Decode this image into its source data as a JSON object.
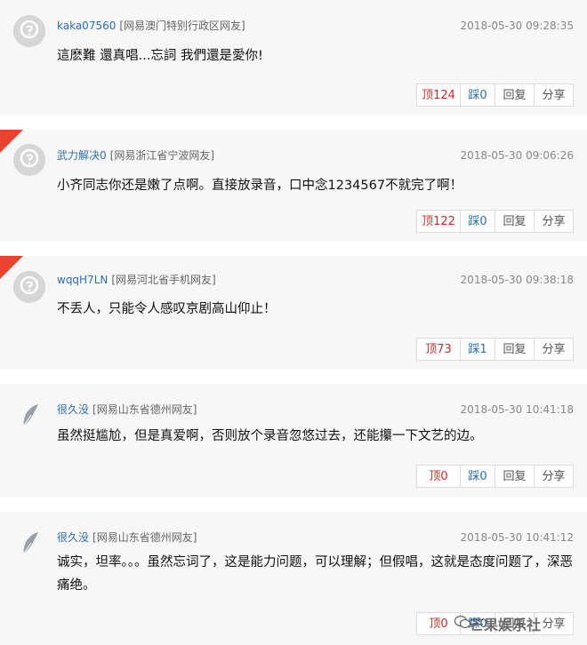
{
  "comments": [
    {
      "username": "kaka07560",
      "location": "[网易澳门特别行政区网友]",
      "timestamp": "2018-05-30 09:28:35",
      "text": "這麽難 還真唱...忘詞 我們還是愛你!",
      "up_label": "顶124",
      "down_label": "踩0",
      "reply_label": "回复",
      "share_label": "分享",
      "hot": false,
      "avatar": "default-avatar"
    },
    {
      "username": "武力解决0",
      "location": "[网易浙江省宁波网友]",
      "timestamp": "2018-05-30 09:06:26",
      "text": "小齐同志你还是嫩了点啊。直接放录音，口中念1234567不就完了啊！",
      "up_label": "顶122",
      "down_label": "踩0",
      "reply_label": "回复",
      "share_label": "分享",
      "hot": true,
      "avatar": "default-avatar"
    },
    {
      "username": "wqqH7LN",
      "location": "[网易河北省手机网友]",
      "timestamp": "2018-05-30 09:38:18",
      "text": "不丢人，只能令人感叹京剧高山仰止！",
      "up_label": "顶73",
      "down_label": "踩1",
      "reply_label": "回复",
      "share_label": "分享",
      "hot": true,
      "avatar": "default-avatar"
    },
    {
      "username": "很久没",
      "location": "[网易山东省德州网友]",
      "timestamp": "2018-05-30 10:41:18",
      "text": "虽然挺尴尬，但是真爱啊，否则放个录音忽悠过去，还能攥一下文艺的边。",
      "up_label": "顶0",
      "down_label": "踩0",
      "reply_label": "回复",
      "share_label": "分享",
      "hot": false,
      "avatar": "feather-avatar"
    },
    {
      "username": "很久没",
      "location": "[网易山东省德州网友]",
      "timestamp": "2018-05-30 10:41:12",
      "text": "诚实，坦率。。。虽然忘词了，这是能力问题，可以理解；但假唱，这就是态度问题了，深恶痛绝。",
      "up_label": "顶0",
      "down_label": "踩0",
      "reply_label": "回复",
      "share_label": "分享",
      "hot": false,
      "avatar": "feather-avatar"
    }
  ],
  "watermark": "芒果娱乐社",
  "colors": {
    "accent_red": "#d7282e",
    "link_blue": "#2c6fb3",
    "hot_flag": "#e8432e",
    "card_bg": "#f7f7f7"
  }
}
